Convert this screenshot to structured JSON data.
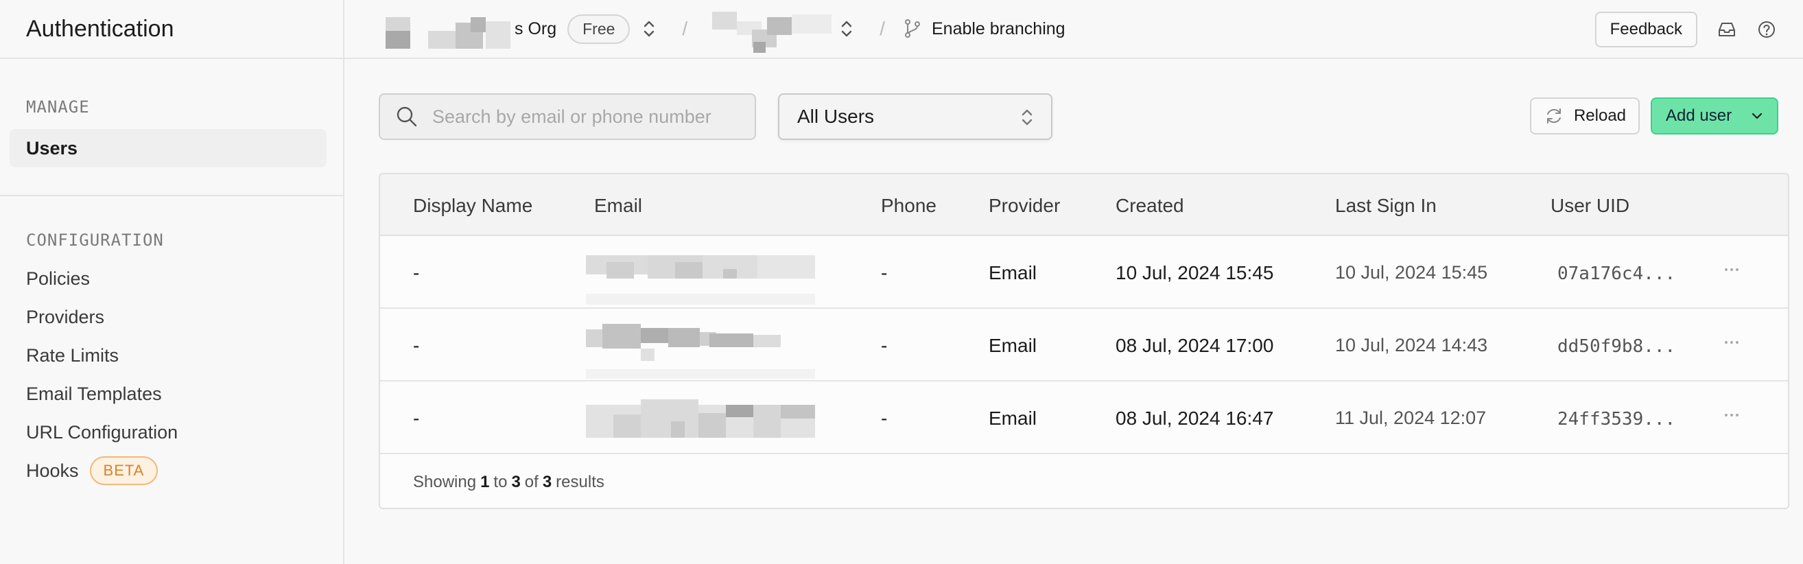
{
  "sidebar": {
    "title": "Authentication",
    "manage_label": "MANAGE",
    "manage_items": [
      {
        "label": "Users",
        "active": true
      }
    ],
    "config_label": "CONFIGURATION",
    "config_items": [
      {
        "label": "Policies"
      },
      {
        "label": "Providers"
      },
      {
        "label": "Rate Limits"
      },
      {
        "label": "Email Templates"
      },
      {
        "label": "URL Configuration"
      },
      {
        "label": "Hooks",
        "badge": "BETA"
      }
    ]
  },
  "topbar": {
    "org_suffix": "s Org",
    "plan": "Free",
    "separator": "/",
    "branch_label": "Enable branching",
    "feedback_label": "Feedback",
    "icons": [
      "branch-icon",
      "inbox-icon",
      "help-icon"
    ]
  },
  "toolbar": {
    "search_placeholder": "Search by email or phone number",
    "filter_value": "All Users",
    "reload_label": "Reload",
    "add_user_label": "Add user"
  },
  "table": {
    "columns": [
      "Display Name",
      "Email",
      "Phone",
      "Provider",
      "Created",
      "Last Sign In",
      "User UID"
    ],
    "rows": [
      {
        "display_name": "-",
        "phone": "-",
        "provider": "Email",
        "created": "10 Jul, 2024 15:45",
        "last_sign_in": "10 Jul, 2024 15:45",
        "uid": "07a176c4..."
      },
      {
        "display_name": "-",
        "phone": "-",
        "provider": "Email",
        "created": "08 Jul, 2024 17:00",
        "last_sign_in": "10 Jul, 2024 14:43",
        "uid": "dd50f9b8..."
      },
      {
        "display_name": "-",
        "phone": "-",
        "provider": "Email",
        "created": "08 Jul, 2024 16:47",
        "last_sign_in": "11 Jul, 2024 12:07",
        "uid": "24ff3539..."
      }
    ],
    "footer": {
      "prefix": "Showing",
      "from": "1",
      "to_word": "to",
      "to": "3",
      "of_word": "of",
      "total": "3",
      "suffix": "results"
    }
  },
  "colors": {
    "accent": "#6ee3a8",
    "accent_border": "#3ecf8e",
    "beta": "#d9822b"
  }
}
